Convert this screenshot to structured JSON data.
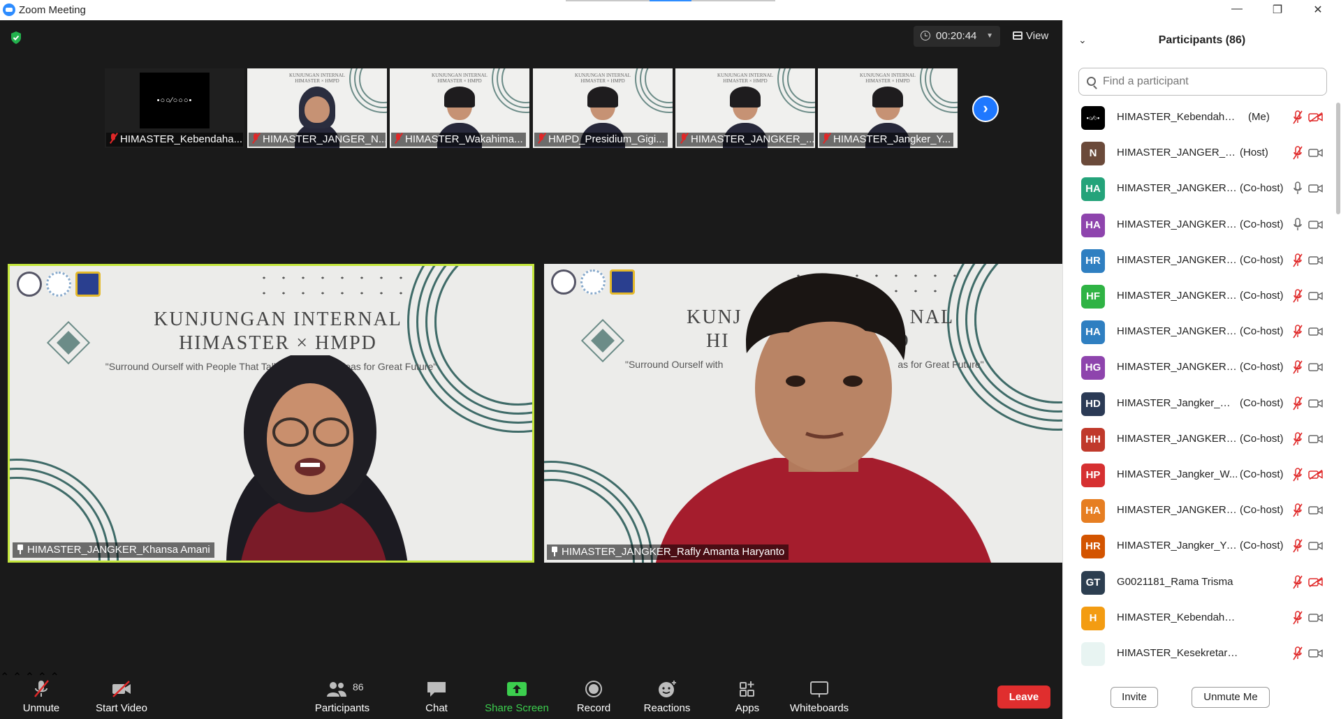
{
  "window": {
    "title": "Zoom Meeting"
  },
  "meeting": {
    "timer": "00:20:44",
    "view_label": "View"
  },
  "thumbnails": [
    {
      "name": "HIMASTER_Kebendaha...",
      "kind": "logo",
      "logo_text": "•○○∕○○○•"
    },
    {
      "name": "HIMASTER_JANGER_N...",
      "kind": "video",
      "hair": "hijab"
    },
    {
      "name": "HIMASTER_Wakahima...",
      "kind": "video",
      "hair": "dark"
    },
    {
      "name": "HMPD_Presidium_Gigi...",
      "kind": "video",
      "hair": "dark"
    },
    {
      "name": "HIMASTER_JANGKER_...",
      "kind": "video",
      "hair": "dark"
    },
    {
      "name": "HIMASTER_Jangker_Y...",
      "kind": "video",
      "hair": "dark"
    }
  ],
  "thumb_slide": {
    "line1": "KUNJUNGAN INTERNAL",
    "line2": "HIMASTER × HMPD"
  },
  "main_tiles": [
    {
      "name": "HIMASTER_JANGKER_Khansa Amani",
      "active": true
    },
    {
      "name": "HIMASTER_JANGKER_Rafly Amanta Haryanto",
      "active": false
    }
  ],
  "slide": {
    "title_line1": "KUNJUNGAN INTERNAL",
    "title_line2": "HIMASTER × HMPD",
    "subtitle_left": "\"Surround Ourself with People That Talk A",
    "subtitle_right": "and Ideas for Great Future\"",
    "subtitle2_left": "\"Surround Ourself with",
    "subtitle2_right": "as for Great Future\"",
    "title2_left": "KUNJ",
    "title2_right": "NAL",
    "title2_line2_left": "HI",
    "title2_line2_right": "D"
  },
  "toolbar": {
    "unmute": "Unmute",
    "start_video": "Start Video",
    "participants": "Participants",
    "participants_count": "86",
    "chat": "Chat",
    "share_screen": "Share Screen",
    "record": "Record",
    "reactions": "Reactions",
    "apps": "Apps",
    "whiteboards": "Whiteboards",
    "leave": "Leave"
  },
  "panel": {
    "title": "Participants (86)",
    "search_placeholder": "Find a participant",
    "invite": "Invite",
    "unmute_me": "Unmute Me",
    "participants": [
      {
        "initials": "",
        "name": "HIMASTER_Kebendaharaan...",
        "role": "(Me)",
        "color": "#000000",
        "mic": "muted",
        "cam": "off",
        "logo": true
      },
      {
        "initials": "N",
        "name": "HIMASTER_JANGER_Nady...",
        "role": "(Host)",
        "color": "#6b4a3a",
        "mic": "muted",
        "cam": "on"
      },
      {
        "initials": "HA",
        "name": "HIMASTER_JANGKER_...",
        "role": "(Co-host)",
        "color": "#24a37a",
        "mic": "on",
        "cam": "on"
      },
      {
        "initials": "HA",
        "name": "HIMASTER_JANGKER_...",
        "role": "(Co-host)",
        "color": "#8e44ad",
        "mic": "on",
        "cam": "on"
      },
      {
        "initials": "HR",
        "name": "HIMASTER_JANGKER_...",
        "role": "(Co-host)",
        "color": "#2f7fc1",
        "mic": "muted",
        "cam": "on"
      },
      {
        "initials": "HF",
        "name": "HIMASTER_JANGKER_J...",
        "role": "(Co-host)",
        "color": "#2fb344",
        "mic": "muted",
        "cam": "on"
      },
      {
        "initials": "HA",
        "name": "HIMASTER_JANGKER_...",
        "role": "(Co-host)",
        "color": "#2f7fc1",
        "mic": "muted",
        "cam": "on"
      },
      {
        "initials": "HG",
        "name": "HIMASTER_JANGKER_...",
        "role": "(Co-host)",
        "color": "#8e44ad",
        "mic": "muted",
        "cam": "on"
      },
      {
        "initials": "HD",
        "name": "HIMASTER_Jangker_M ...",
        "role": "(Co-host)",
        "color": "#2b3a55",
        "mic": "muted",
        "cam": "on"
      },
      {
        "initials": "HH",
        "name": "HIMASTER_JANGKER_...",
        "role": "(Co-host)",
        "color": "#c0392b",
        "mic": "muted",
        "cam": "on"
      },
      {
        "initials": "HP",
        "name": "HIMASTER_Jangker_W...",
        "role": "(Co-host)",
        "color": "#d63031",
        "mic": "muted",
        "cam": "off"
      },
      {
        "initials": "HA",
        "name": "HIMASTER_JANGKER_...",
        "role": "(Co-host)",
        "color": "#e67e22",
        "mic": "muted",
        "cam": "on"
      },
      {
        "initials": "HR",
        "name": "HIMASTER_Jangker_Yu...",
        "role": "(Co-host)",
        "color": "#d35400",
        "mic": "muted",
        "cam": "on"
      },
      {
        "initials": "GT",
        "name": "G0021181_Rama Trisma",
        "role": "",
        "color": "#2c3e50",
        "mic": "muted",
        "cam": "off"
      },
      {
        "initials": "H",
        "name": "HIMASTER_Kebendaharaan_Naila",
        "role": "",
        "color": "#f39c12",
        "mic": "muted",
        "cam": "on"
      },
      {
        "initials": "",
        "name": "HIMASTER_Kesekretariatan_Fadh...",
        "role": "",
        "color": "#e8f4f2",
        "mic": "muted",
        "cam": "on"
      }
    ]
  },
  "colors": {
    "accent": "#2d8cff",
    "leave": "#e02e2e",
    "share": "#3ccf4e",
    "active_border": "#c3e63b",
    "muted_red": "#e02828"
  }
}
